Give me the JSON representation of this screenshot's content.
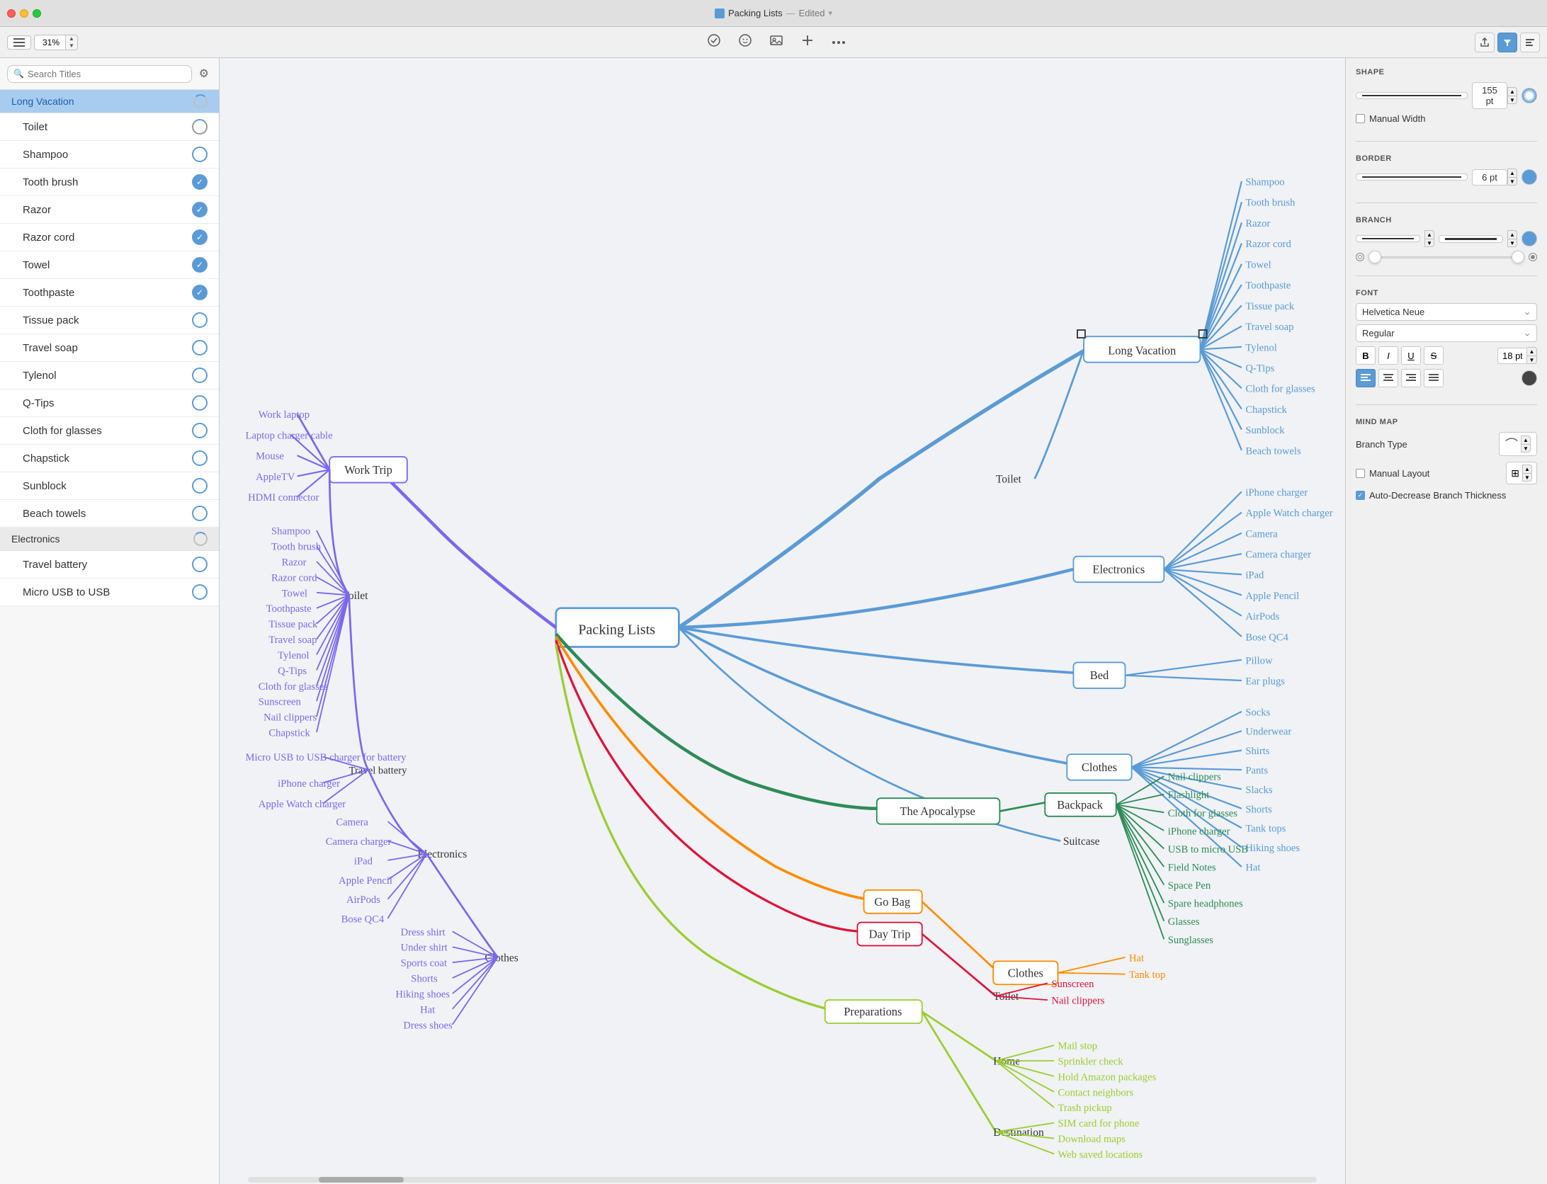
{
  "window": {
    "title": "Packing Lists",
    "subtitle": "Edited",
    "traffic_lights": [
      "red",
      "yellow",
      "green"
    ]
  },
  "toolbar": {
    "zoom_value": "31%",
    "zoom_up": "▲",
    "zoom_down": "▼",
    "icons": [
      "☑",
      "😊",
      "🖼",
      "✛",
      "•••"
    ]
  },
  "sidebar": {
    "search_placeholder": "Search Titles",
    "settings_icon": "⚙",
    "groups": [
      {
        "id": "long-vacation",
        "label": "Long Vacation",
        "active": true,
        "spinner": true,
        "items": [
          {
            "id": "toilet",
            "label": "Toilet",
            "checked": false,
            "loading": true
          },
          {
            "id": "shampoo",
            "label": "Shampoo",
            "checked": false,
            "loading": false
          },
          {
            "id": "tooth-brush",
            "label": "Tooth brush",
            "checked": true,
            "loading": false
          },
          {
            "id": "razor",
            "label": "Razor",
            "checked": true,
            "loading": false
          },
          {
            "id": "razor-cord",
            "label": "Razor cord",
            "checked": true,
            "loading": false
          },
          {
            "id": "towel",
            "label": "Towel",
            "checked": true,
            "loading": false
          },
          {
            "id": "toothpaste",
            "label": "Toothpaste",
            "checked": true,
            "loading": false
          },
          {
            "id": "tissue-pack",
            "label": "Tissue pack",
            "checked": false,
            "loading": false
          },
          {
            "id": "travel-soap",
            "label": "Travel soap",
            "checked": false,
            "loading": false
          },
          {
            "id": "tylenol",
            "label": "Tylenol",
            "checked": false,
            "loading": false
          },
          {
            "id": "q-tips",
            "label": "Q-Tips",
            "checked": false,
            "loading": false
          },
          {
            "id": "cloth-for-glasses",
            "label": "Cloth for glasses",
            "checked": false,
            "loading": false
          },
          {
            "id": "chapstick",
            "label": "Chapstick",
            "checked": false,
            "loading": false
          },
          {
            "id": "sunblock",
            "label": "Sunblock",
            "checked": false,
            "loading": false
          },
          {
            "id": "beach-towels",
            "label": "Beach towels",
            "checked": false,
            "loading": false
          }
        ]
      },
      {
        "id": "electronics",
        "label": "Electronics",
        "active": false,
        "spinner": true,
        "items": [
          {
            "id": "travel-battery",
            "label": "Travel battery",
            "checked": false,
            "loading": false
          },
          {
            "id": "micro-usb",
            "label": "Micro USB to USB",
            "checked": false,
            "loading": false
          }
        ]
      }
    ]
  },
  "canvas": {
    "center_node": "Packing Lists",
    "branches": [
      {
        "label": "Long Vacation",
        "color": "#5b9bd5"
      },
      {
        "label": "Work Trip",
        "color": "#7b68ee"
      },
      {
        "label": "The Apocalypse",
        "color": "#228b22"
      },
      {
        "label": "Go Bag",
        "color": "#ff8c00"
      },
      {
        "label": "Day Trip",
        "color": "#ff4500"
      },
      {
        "label": "Preparations",
        "color": "#9acd32"
      }
    ]
  },
  "right_panel": {
    "shape_label": "SHAPE",
    "manual_width_label": "Manual Width",
    "shape_pt_value": "155 pt",
    "border_label": "BORDER",
    "border_pt_value": "6 pt",
    "border_color": "#5b9bd5",
    "branch_label": "BRANCH",
    "font_label": "FONT",
    "font_family": "Helvetica Neue",
    "font_style": "Regular",
    "font_size": "18 pt",
    "bold_label": "B",
    "italic_label": "I",
    "underline_label": "U",
    "strikethrough_label": "S",
    "align_left": "≡",
    "align_center": "≡",
    "align_right": "≡",
    "align_justify": "≡",
    "font_color": "#444",
    "mind_map_label": "MIND MAP",
    "branch_type_label": "Branch Type",
    "manual_layout_label": "Manual Layout",
    "auto_decrease_label": "Auto-Decrease Branch Thickness",
    "layout_icon": "⊞"
  }
}
